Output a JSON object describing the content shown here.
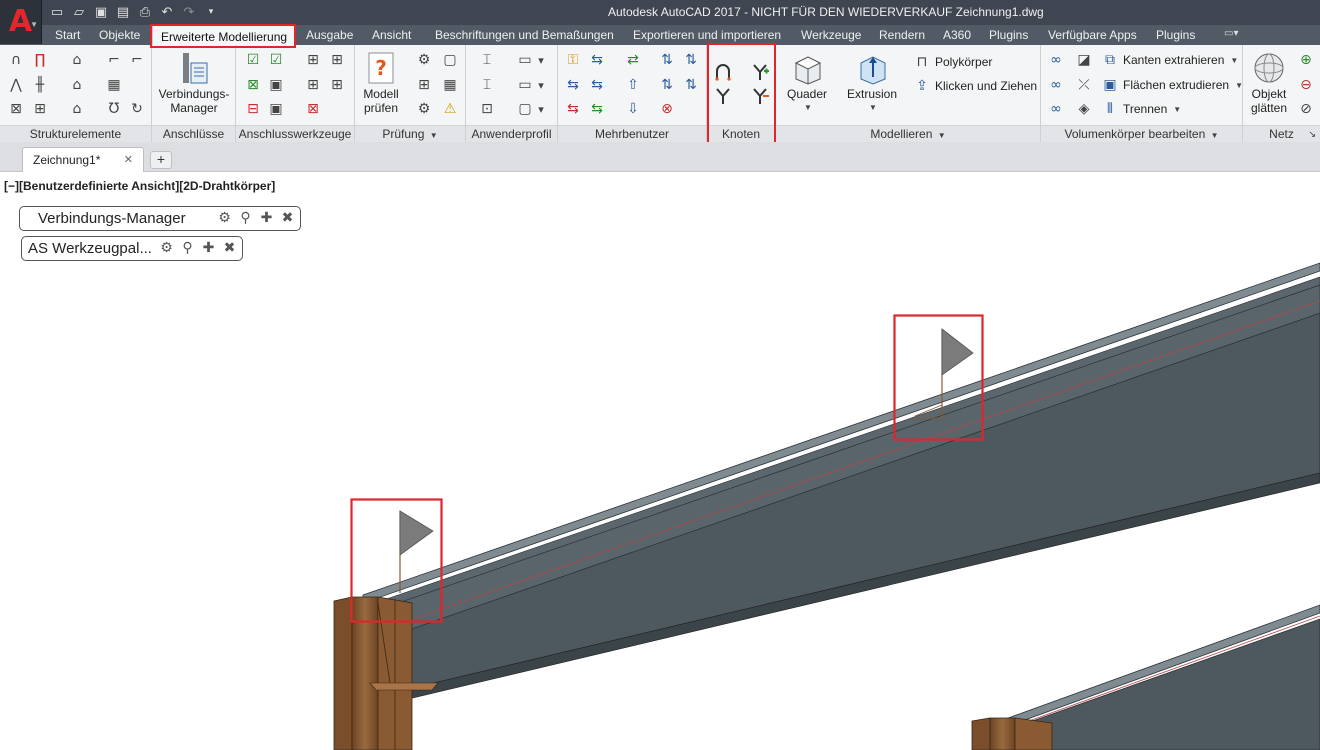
{
  "window": {
    "title": "Autodesk AutoCAD 2017 - NICHT FÜR DEN WIEDERVERKAUF    Zeichnung1.dwg",
    "app_logo": "A"
  },
  "quick_access": {
    "icons": [
      "new-icon",
      "open-icon",
      "save-icon",
      "save-as-icon",
      "print-icon",
      "undo-icon",
      "redo-icon",
      "customize-icon"
    ]
  },
  "tabs": [
    {
      "label": "Start"
    },
    {
      "label": "Objekte"
    },
    {
      "label": "Erweiterte Modellierung"
    },
    {
      "label": "Ausgabe"
    },
    {
      "label": "Ansicht"
    },
    {
      "label": "Beschriftungen und Bemaßungen"
    },
    {
      "label": "Exportieren und importieren"
    },
    {
      "label": "Werkzeuge"
    },
    {
      "label": "Rendern"
    },
    {
      "label": "A360"
    },
    {
      "label": "Plugins"
    },
    {
      "label": "Verfügbare Apps"
    },
    {
      "label": "Plugins"
    }
  ],
  "active_tab": "Erweiterte Modellierung",
  "panels": {
    "strukturelemente": {
      "title": "Strukturelemente"
    },
    "anschluesse": {
      "title": "Anschlüsse",
      "manager_label_1": "Verbindungs-",
      "manager_label_2": "Manager"
    },
    "anschlusswerkzeuge": {
      "title": "Anschlusswerkzeuge"
    },
    "pruefung": {
      "title": "Prüfung",
      "model_check_1": "Modell",
      "model_check_2": "prüfen"
    },
    "anwenderprofil": {
      "title": "Anwenderprofil"
    },
    "mehrbenutzer": {
      "title": "Mehrbenutzer"
    },
    "knoten": {
      "title": "Knoten"
    },
    "modellieren": {
      "title": "Modellieren",
      "quader": "Quader",
      "extrusion": "Extrusion",
      "polykoerper": "Polykörper",
      "klicken": "Klicken und Ziehen"
    },
    "volumen": {
      "title": "Volumenkörper bearbeiten",
      "kanten": "Kanten extrahieren",
      "flaechen": "Flächen extrudieren",
      "trennen": "Trennen"
    },
    "netz": {
      "title": "Netz",
      "objekt_1": "Objekt",
      "objekt_2": "glätten"
    }
  },
  "file_tab": {
    "label": "Zeichnung1*",
    "close": "✕",
    "new": "+"
  },
  "viewport": {
    "label": "[−][Benutzerdefinierte Ansicht][2D-Drahtkörper]",
    "palettes": [
      {
        "title": "Verbindungs-Manager"
      },
      {
        "title": "AS Werkzeugpal..."
      }
    ]
  },
  "colors": {
    "highlight": "#e0262b",
    "beam": "#4e585f",
    "column": "#8a5a33"
  }
}
